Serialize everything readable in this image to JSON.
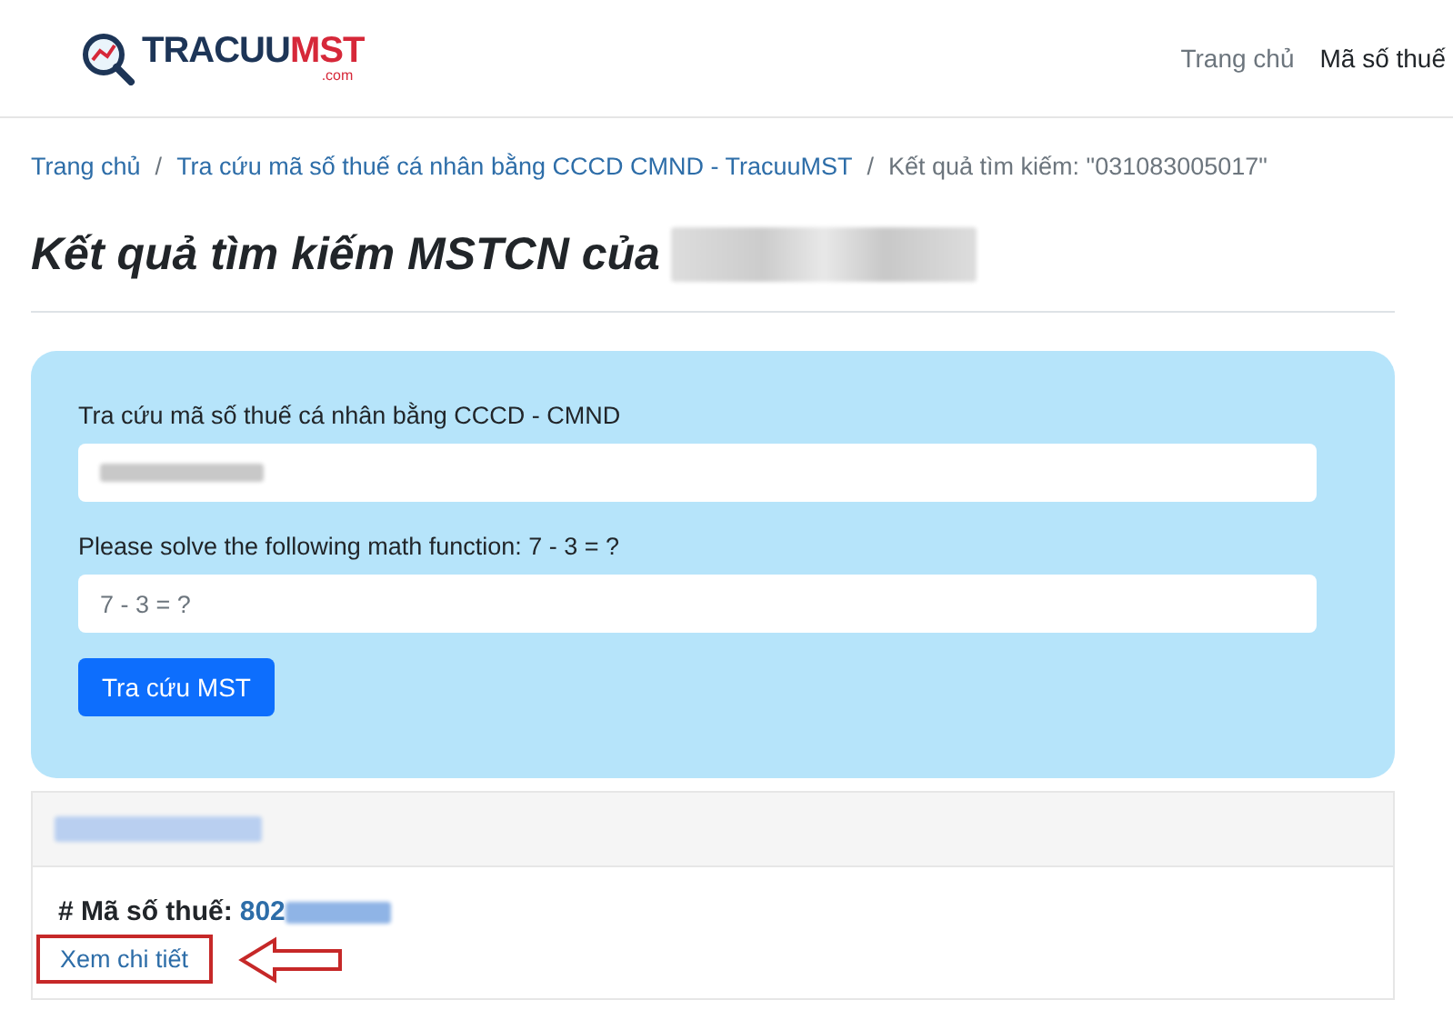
{
  "header": {
    "logo": {
      "main": "TRACUU",
      "accent": "MST",
      "suffix": ".com"
    },
    "nav": [
      {
        "label": "Trang chủ",
        "selected": false
      },
      {
        "label": "Mã số thuế",
        "selected": true
      }
    ]
  },
  "breadcrumb_separators": [
    "/",
    "/"
  ],
  "breadcrumb": [
    {
      "label": "Trang chủ",
      "kind": "link"
    },
    {
      "label": "Tra cứu mã số thuế cá nhân bằng CCCD CMND - TracuuMST",
      "kind": "link"
    },
    {
      "label": "Kết quả tìm kiếm: \"031083005017\"",
      "kind": "current"
    }
  ],
  "title": {
    "text": "Kết quả tìm kiếm MSTCN của",
    "redacted": true
  },
  "search_form": {
    "fields": [
      {
        "label": "Tra cứu mã số thuế cá nhân bằng CCCD - CMND",
        "redacted": true
      },
      {
        "label": "Please solve the following math function: 7 - 3 = ?",
        "placeholder": "7 - 3 = ?"
      }
    ],
    "button": "Tra cứu MST"
  },
  "result": {
    "name_redacted": true,
    "tax_label": "# Mã số thuế:",
    "tax_number": "802",
    "tax_redacted": true,
    "detail_link": "Xem chi tiết",
    "highlighted": true
  }
}
